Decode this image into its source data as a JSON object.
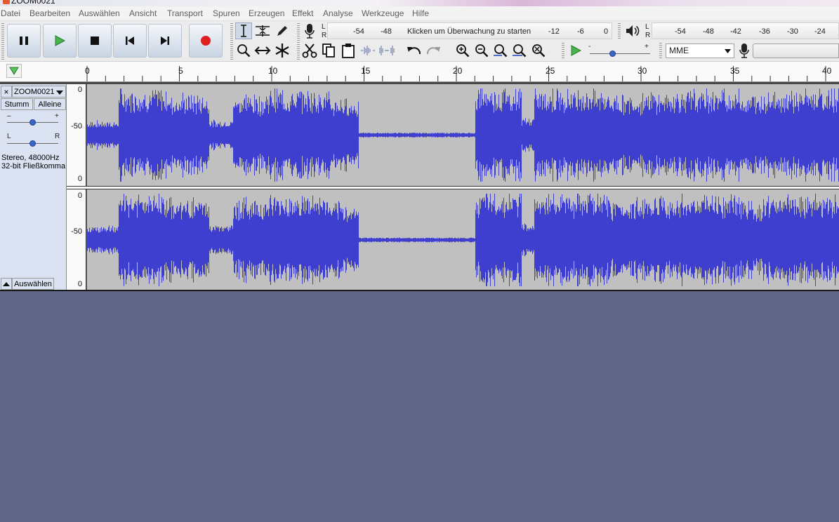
{
  "window": {
    "title": "ZOOM0021"
  },
  "menu": [
    "Datei",
    "Bearbeiten",
    "Auswählen",
    "Ansicht",
    "Transport",
    "Spuren",
    "Erzeugen",
    "Effekt",
    "Analyse",
    "Werkzeuge",
    "Hilfe"
  ],
  "transport": [
    "pause",
    "play",
    "stop",
    "skip-start",
    "skip-end",
    "record"
  ],
  "record_meter": {
    "L": "L",
    "R": "R",
    "ticks": [
      "-54",
      "-48",
      "-12",
      "-6",
      "0"
    ],
    "prompt": "Klicken um Überwachung zu starten"
  },
  "play_meter": {
    "L": "L",
    "R": "R",
    "ticks": [
      "-54",
      "-48",
      "-42",
      "-36",
      "-30",
      "-24"
    ]
  },
  "playback_speed": {
    "minus": "-",
    "plus": "+",
    "level": 0.38
  },
  "device": {
    "host": "MME"
  },
  "ruler": {
    "ticks": [
      "0",
      "5",
      "10",
      "15",
      "20",
      "25",
      "30",
      "35",
      "40"
    ]
  },
  "track": {
    "name": "ZOOM0021",
    "close": "×",
    "mute": "Stumm",
    "solo": "Alleine",
    "gain_minus": "–",
    "gain_plus": "+",
    "pan_left": "L",
    "pan_right": "R",
    "gain_level": 0.5,
    "pan_level": 0.5,
    "info_line1": "Stereo, 48000Hz",
    "info_line2": "32-bit Fließkomma",
    "select_button": "Auswählen",
    "channel1_scale": [
      "0",
      "-50",
      "0"
    ],
    "channel2_scale": [
      "0",
      "-50",
      "0"
    ]
  },
  "colors": {
    "waveform": "#3f3fcf",
    "wave_background": "#c0c0c0",
    "workspace": "#5f6585"
  }
}
